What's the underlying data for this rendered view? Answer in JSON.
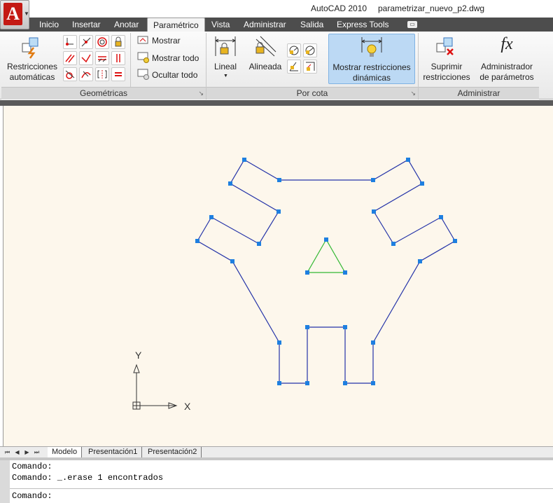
{
  "window": {
    "app_title": "AutoCAD 2010",
    "file_name": "parametrizar_nuevo_p2.dwg"
  },
  "app_button": {
    "logo_letter": "A",
    "icon": "autocad-logo-icon"
  },
  "tabs": [
    {
      "label": "Inicio"
    },
    {
      "label": "Insertar"
    },
    {
      "label": "Anotar"
    },
    {
      "label": "Paramétrico",
      "active": true
    },
    {
      "label": "Vista"
    },
    {
      "label": "Administrar"
    },
    {
      "label": "Salida"
    },
    {
      "label": "Express Tools"
    }
  ],
  "ribbon": {
    "auto_constraints": {
      "line1": "Restricciones",
      "line2": "automáticas"
    },
    "show": "Mostrar",
    "show_all": "Mostrar todo",
    "hide_all": "Ocultar todo",
    "linear": "Lineal",
    "aligned": "Alineada",
    "show_dynamic": {
      "line1": "Mostrar restricciones",
      "line2": "dinámicas"
    },
    "delete_constraints": {
      "line1": "Suprimir",
      "line2": "restricciones"
    },
    "param_manager": {
      "line1": "Administrador",
      "line2": "de parámetros"
    },
    "fx_symbol": "fx",
    "panels": {
      "geometric": "Geométricas",
      "dimensional": "Por cota",
      "manage": "Administrar"
    }
  },
  "drawing": {
    "y_axis_label": "Y",
    "x_axis_label": "X",
    "outline_color": "#2433a8",
    "triangle_color": "#33b833",
    "grip_color": "#1e7fe0",
    "background": "#fdf7ec"
  },
  "layout_tabs": [
    "Modelo",
    "Presentación1",
    "Presentación2"
  ],
  "command": {
    "line1": "Comando:",
    "line2": "Comando: _.erase 1 encontrados",
    "prompt": "Comando:"
  }
}
